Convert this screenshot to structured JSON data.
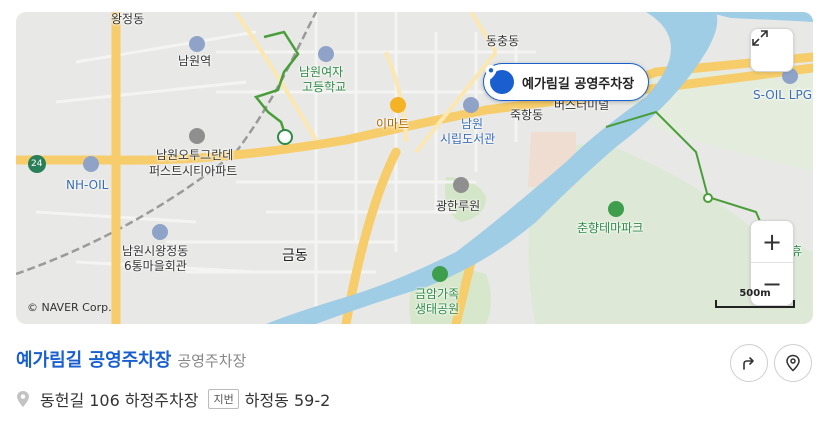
{
  "map": {
    "labels": {
      "wangjeong": "왕정동",
      "namwon_station": "남원역",
      "girls_high_1": "남원여자",
      "girls_high_2": "고등학교",
      "dongchung": "동충동",
      "emart": "이마트",
      "library_1": "남원",
      "library_2": "시립도서관",
      "jukhang": "죽항동",
      "bus_terminal": "버스터미널",
      "soil_lpg": "S-OIL LPG",
      "apt_1": "남원오투그란데",
      "apt_2": "퍼스트시티아파트",
      "route": "24",
      "nh_oil": "NH-OIL",
      "gwanghallu": "광한루원",
      "chunhyang_park": "춘향테마파크",
      "community_1": "남원시왕정동",
      "community_2": "6통마을회관",
      "geumdong": "금동",
      "eco_park_1": "금암가족",
      "eco_park_2": "생태공원",
      "partial_right": "휴"
    },
    "marker": {
      "name": "예가림길 공영주차장",
      "color": "#1a5fd0"
    },
    "copyright": "© NAVER Corp.",
    "scale_label": "500m",
    "controls": {
      "fullscreen_icon": "expand-icon",
      "zoom_in": "+",
      "zoom_out": "−"
    }
  },
  "place": {
    "name": "예가림길 공영주차장",
    "category": "공영주차장",
    "address": "동헌길 106 하정주차장",
    "jibun_badge": "지번",
    "lot_address": "하정동 59-2",
    "accent": "#1a5fd0"
  },
  "actions": {
    "directions_icon": "directions-arrow-icon",
    "location_icon": "map-pin-icon"
  }
}
